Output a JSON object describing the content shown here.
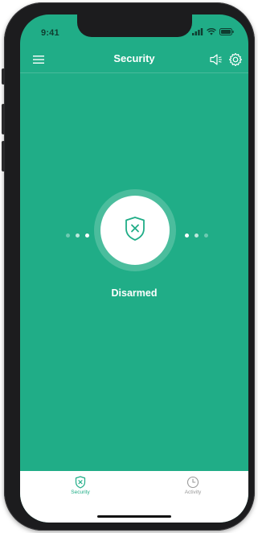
{
  "status_bar": {
    "time": "9:41"
  },
  "header": {
    "title": "Security"
  },
  "main": {
    "status_label": "Disarmed"
  },
  "tabs": [
    {
      "label": "Security",
      "active": true
    },
    {
      "label": "Activity",
      "active": false
    }
  ],
  "colors": {
    "background": "#20ad87",
    "ring": "#4bbd9d",
    "active_tab": "#20ad87",
    "inactive_tab": "#9a9a9a"
  },
  "icons": {
    "menu": "hamburger-menu-icon",
    "speaker": "speaker-icon",
    "settings": "gear-icon",
    "shield": "shield-x-icon",
    "activity": "clock-icon"
  }
}
